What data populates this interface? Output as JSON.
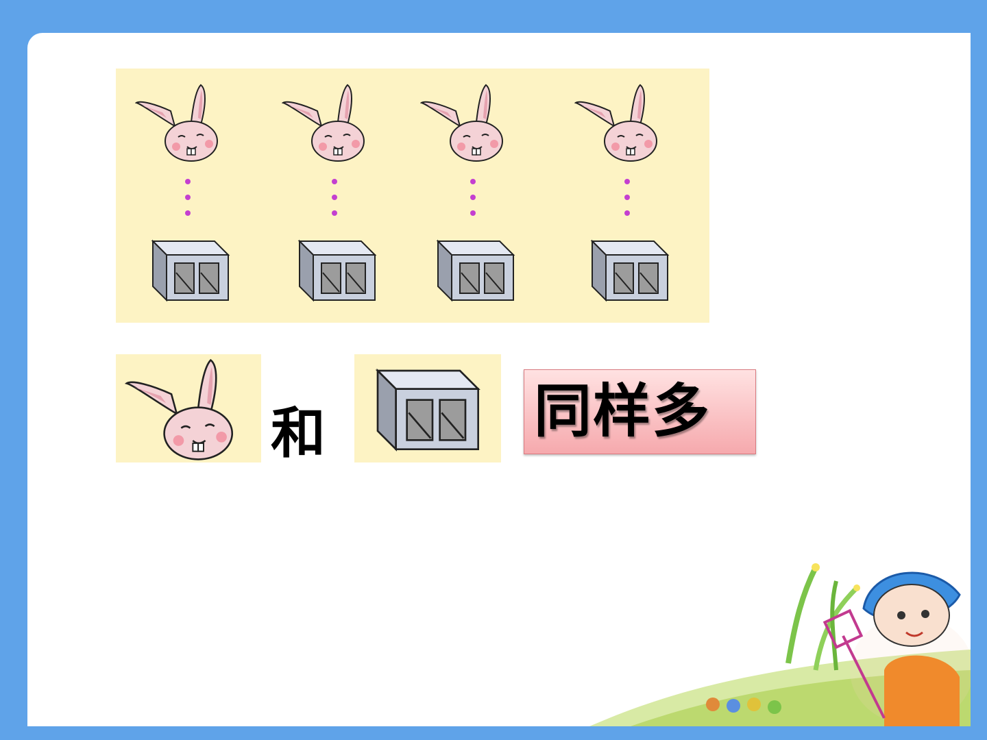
{
  "slide": {
    "pairs": [
      {
        "animal": "rabbit-icon",
        "object": "box-icon"
      },
      {
        "animal": "rabbit-icon",
        "object": "box-icon"
      },
      {
        "animal": "rabbit-icon",
        "object": "box-icon"
      },
      {
        "animal": "rabbit-icon",
        "object": "box-icon"
      }
    ],
    "connector_text": "和",
    "answer_text": "同样多"
  },
  "colors": {
    "frame": "#5fa3e9",
    "panel": "#fdf3c4",
    "answer_bg": "#f6a9ad"
  }
}
